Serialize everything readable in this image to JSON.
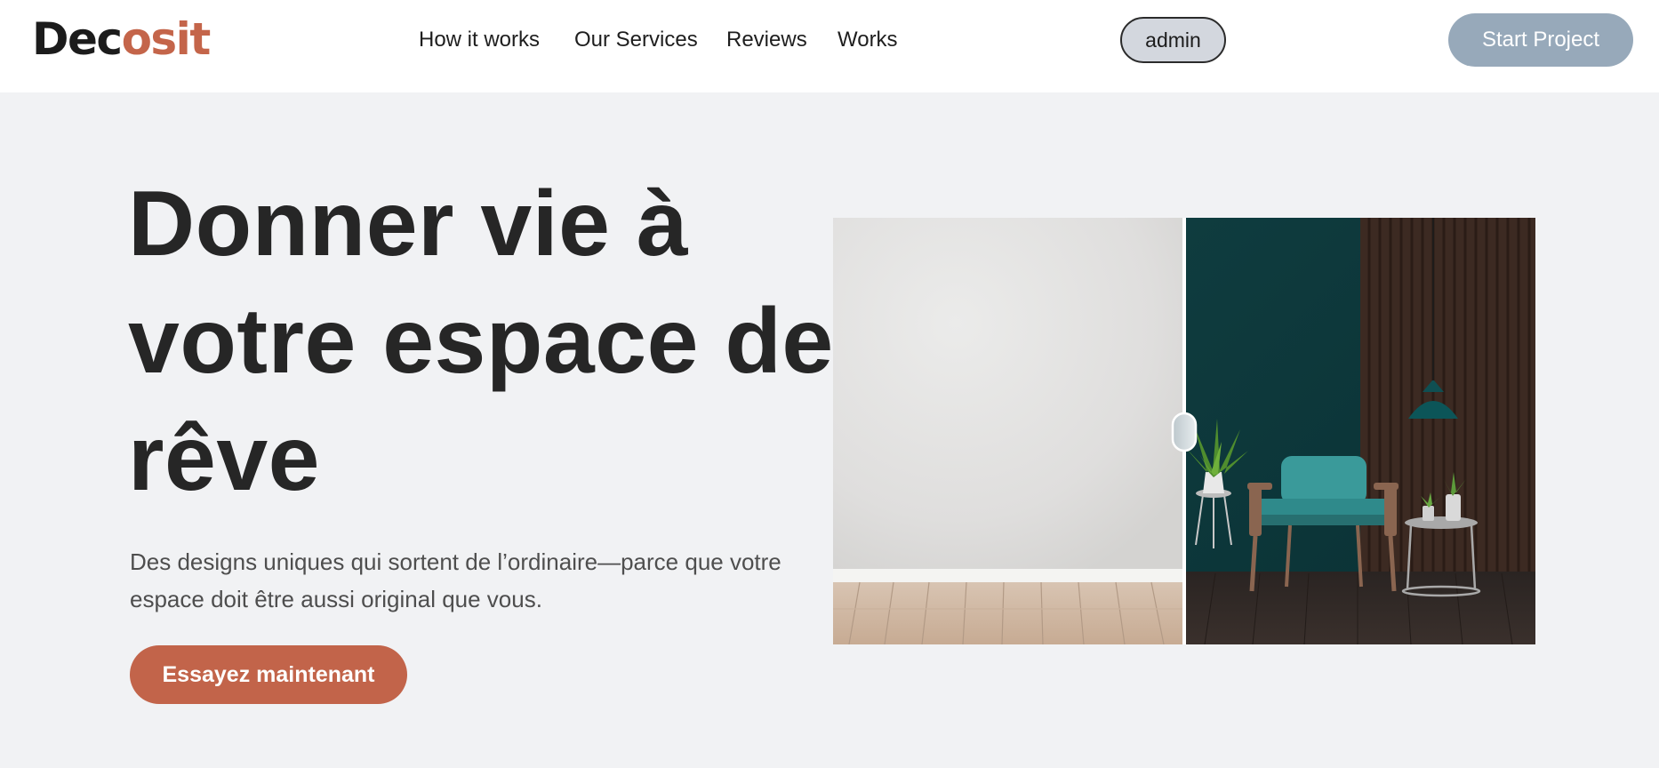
{
  "header": {
    "logo_part1": "Dec",
    "logo_part2": "osit",
    "nav": [
      {
        "label": "How it works"
      },
      {
        "label": "Our Services"
      },
      {
        "label": "Reviews"
      },
      {
        "label": "Works"
      }
    ],
    "admin_label": "admin",
    "start_label": "Start Project"
  },
  "hero": {
    "title": "Donner vie à votre espace de rêve",
    "subtitle": "Des designs uniques qui sortent de l’ordinaire—parce que votre espace doit être aussi original que vous.",
    "cta_label": "Essayez maintenant"
  },
  "comparison": {
    "before_image": "empty-room-concrete-wall-wood-floor",
    "after_image": "furnished-room-teal-armchair-plant",
    "handle_icon": "slider-handle-icon",
    "slider_position": 0.5
  },
  "colors": {
    "accent": "#c4654a",
    "start_button": "#97a9ba",
    "admin_pill": "#d3d7de",
    "background": "#f1f2f4"
  }
}
